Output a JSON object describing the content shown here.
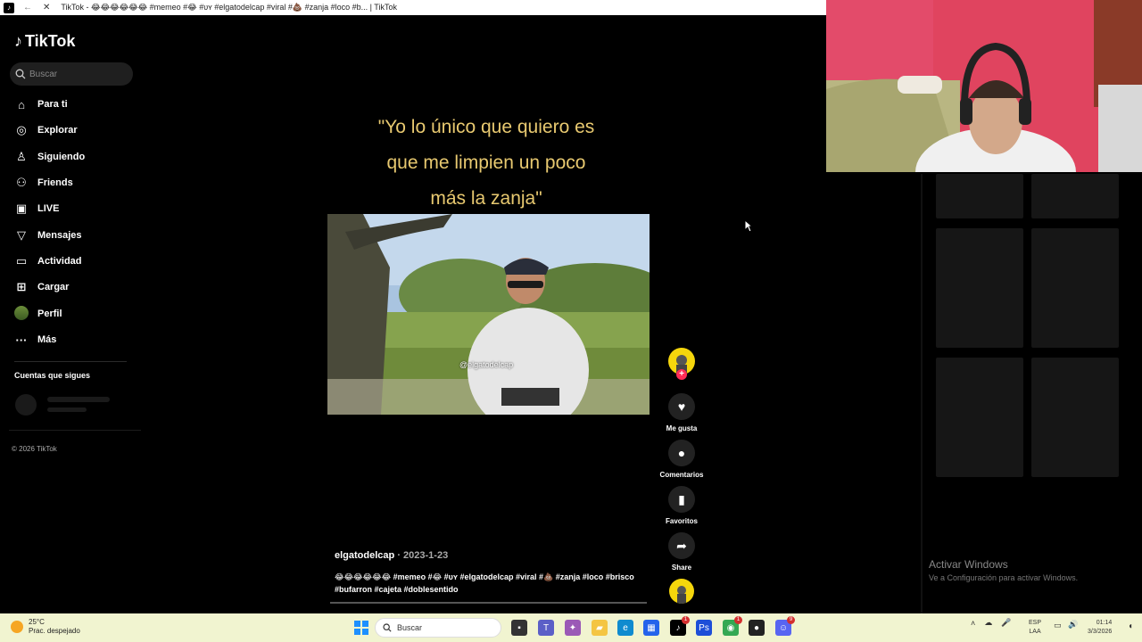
{
  "browser": {
    "tab_title": "TikTok - 😂😂😂😂😂😂 #memeo #😂 #ᴜʏ #elgatodelcap #viral #💩 #zanja #loco #b... | TikTok"
  },
  "sidebar": {
    "logo": "TikTok",
    "search_placeholder": "Buscar",
    "items": [
      {
        "label": "Para ti",
        "icon": "home-icon"
      },
      {
        "label": "Explorar",
        "icon": "compass-icon"
      },
      {
        "label": "Siguiendo",
        "icon": "user-follow-icon"
      },
      {
        "label": "Friends",
        "icon": "friends-icon"
      },
      {
        "label": "LIVE",
        "icon": "live-icon"
      },
      {
        "label": "Mensajes",
        "icon": "send-icon"
      },
      {
        "label": "Actividad",
        "icon": "activity-icon"
      },
      {
        "label": "Cargar",
        "icon": "upload-icon"
      },
      {
        "label": "Perfil",
        "icon": "profile-avatar"
      },
      {
        "label": "Más",
        "icon": "more-icon"
      }
    ],
    "following_title": "Cuentas que sigues",
    "copyright": "© 2026 TikTok"
  },
  "video": {
    "caption_lines": [
      "\"Yo lo único que quiero es",
      "que me limpien un poco",
      "más la zanja\""
    ],
    "watermark": "@elgatodelcap",
    "author": "elgatodelcap",
    "date": "· 2023-1-23",
    "description": "😂😂😂😂😂😂 #memeo #😂 #ᴜʏ #elgatodelcap #viral #💩 #zanja #loco #brisco #bufarron #cajeta #doblesentido"
  },
  "actions": {
    "like": "Me gusta",
    "comments": "Comentarios",
    "favorites": "Favoritos",
    "share": "Share"
  },
  "windows": {
    "activate_title": "Activar Windows",
    "activate_sub": "Ve a Configuración para activar Windows."
  },
  "taskbar": {
    "temp": "25°C",
    "weather": "Prac. despejado",
    "search": "Buscar",
    "lang1": "ESP",
    "lang2": "LAA",
    "time": "01:14",
    "date": "3/3/2026",
    "badges": {
      "tiktok": "1",
      "chrome": "1",
      "discord": "9"
    }
  }
}
